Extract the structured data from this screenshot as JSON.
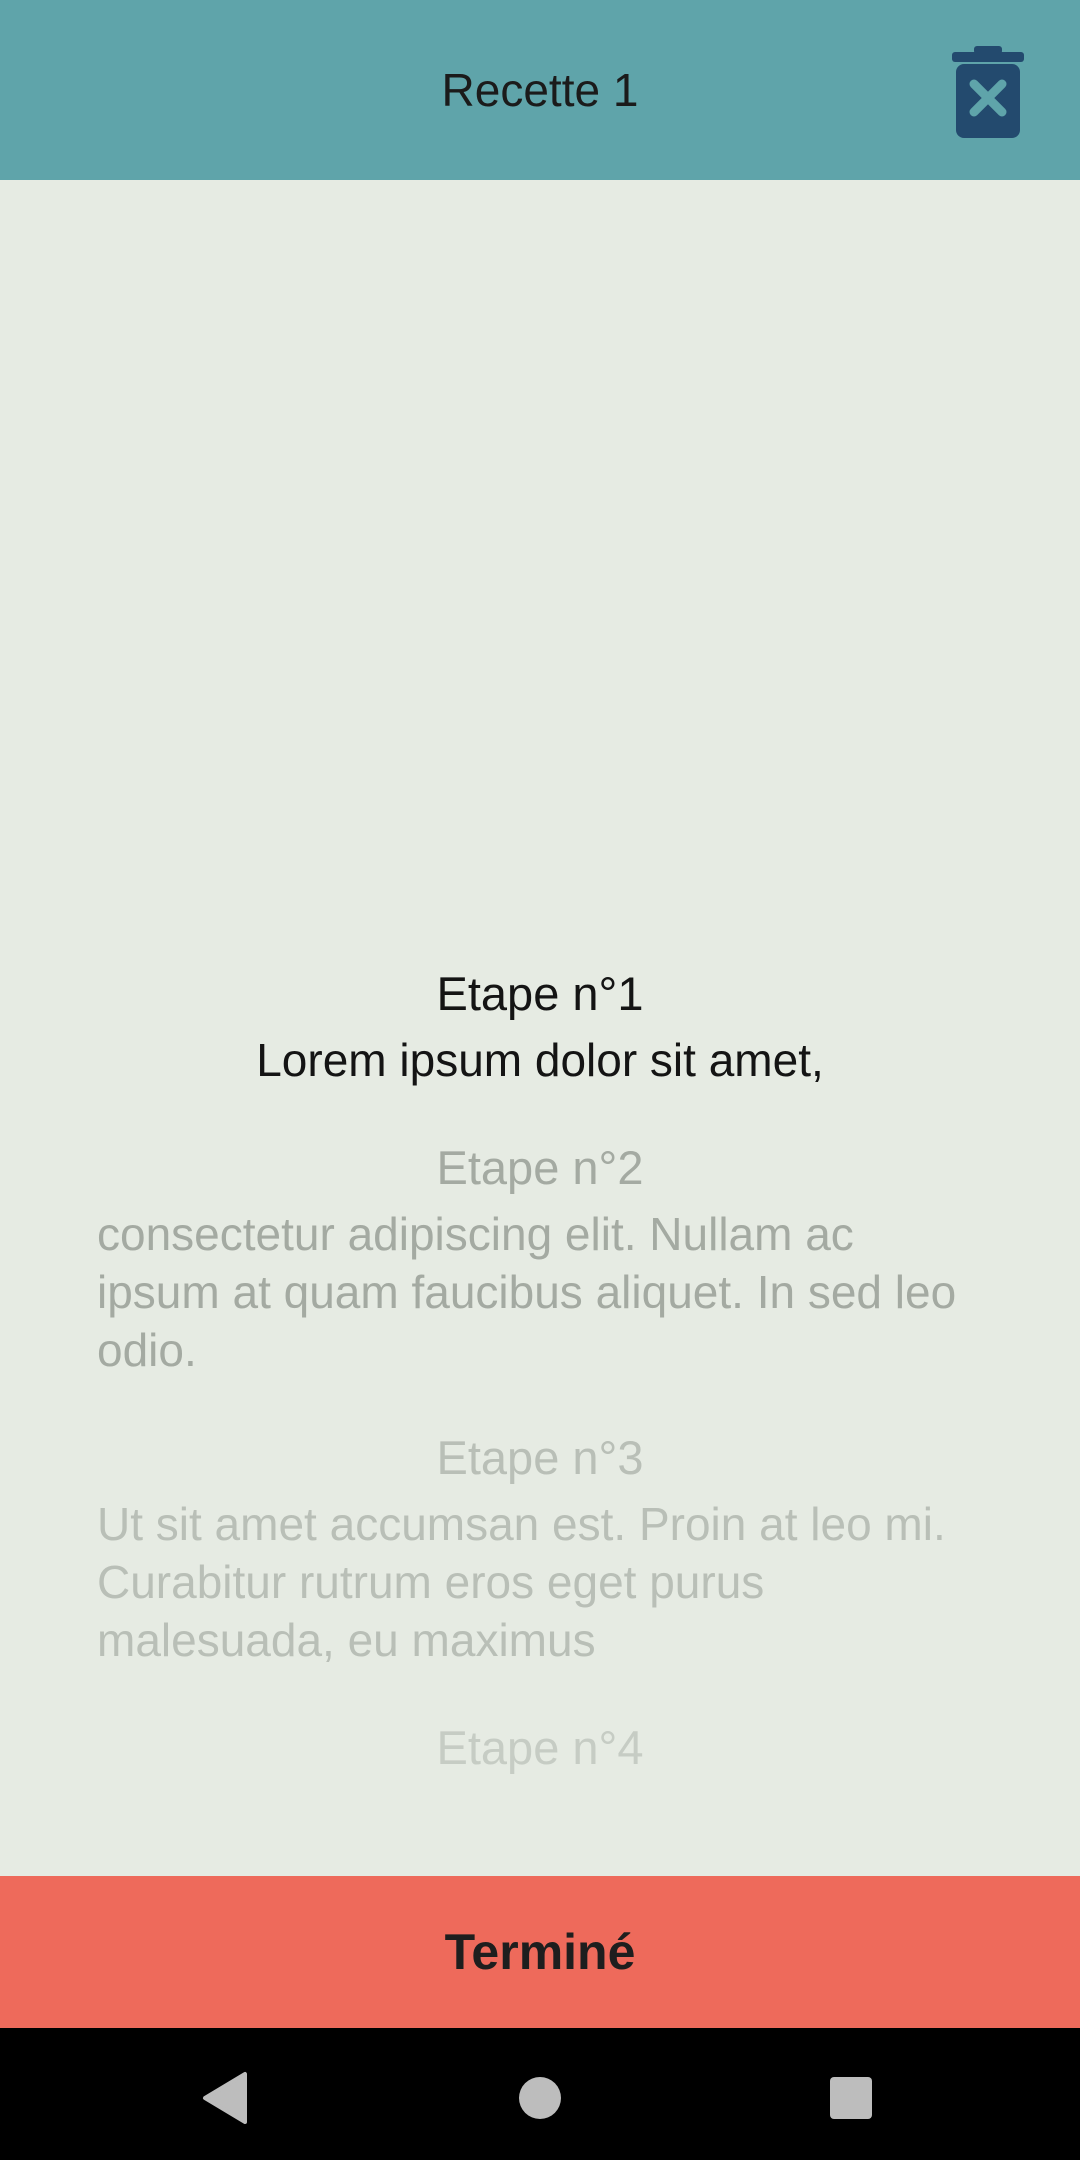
{
  "header": {
    "title": "Recette 1",
    "delete_icon": "trash-x-icon"
  },
  "steps": [
    {
      "title": "Etape n°1",
      "text": "Lorem ipsum dolor sit amet,"
    },
    {
      "title": "Etape n°2",
      "text": "consectetur adipiscing elit. Nullam ac ipsum at quam faucibus aliquet. In sed leo odio."
    },
    {
      "title": "Etape n°3",
      "text": "Ut sit amet accumsan est. Proin at leo mi. Curabitur rutrum eros eget purus malesuada, eu maximus"
    },
    {
      "title": "Etape n°4",
      "text": ""
    }
  ],
  "footer": {
    "done_label": "Terminé"
  },
  "system_nav": {
    "back_icon": "back-triangle-icon",
    "home_icon": "home-circle-icon",
    "recents_icon": "recents-square-icon"
  },
  "colors": {
    "header_bg": "#5fa4aa",
    "content_bg": "#e6ebe3",
    "done_button_bg": "#ee6a5b",
    "trash_icon": "#234a6e"
  }
}
